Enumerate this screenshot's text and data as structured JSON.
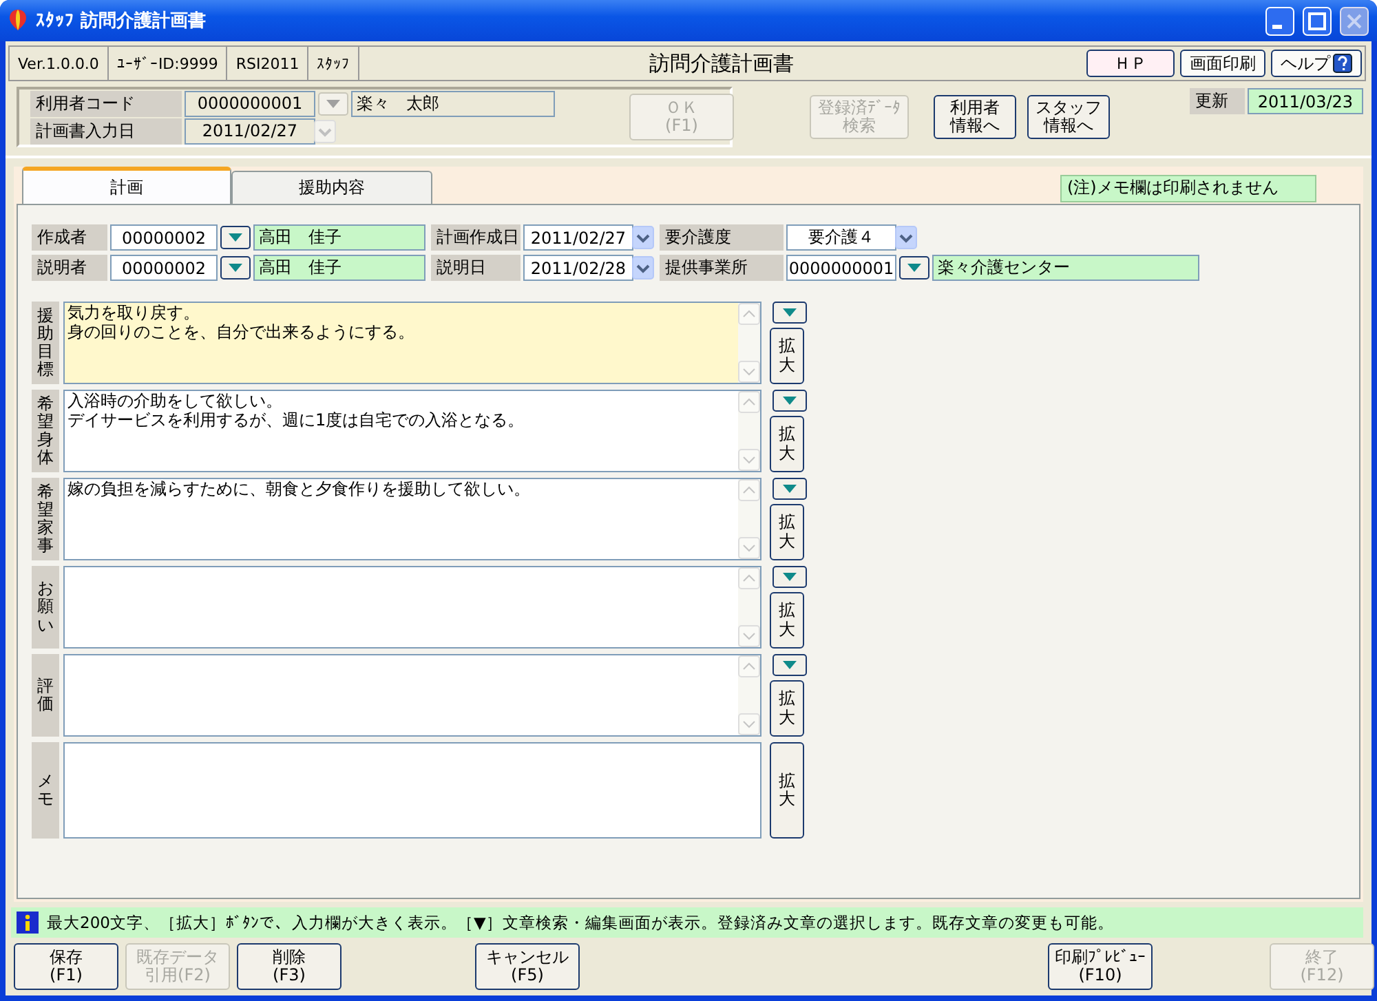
{
  "window": {
    "title": "ｽﾀｯﾌ 訪問介護計画書"
  },
  "info_bar": {
    "cells": [
      "Ver.1.0.0.0",
      "ﾕｰｻﾞｰID:9999",
      "RSI2011",
      "ｽﾀｯﾌ"
    ],
    "screen_title": "訪問介護計画書",
    "buttons": [
      {
        "label": "ＨＰ",
        "kind": "plain"
      },
      {
        "label": "画面印刷",
        "kind": "plain"
      },
      {
        "label": "ヘルプ",
        "kind": "help"
      }
    ]
  },
  "header": {
    "user_code": {
      "label": "利用者コード",
      "value": "0000000001",
      "name": "楽々　太郎",
      "disabled": true
    },
    "plan_date": {
      "label": "計画書入力日",
      "value": "2011/02/27",
      "disabled": true
    },
    "ok_button": {
      "lines": [
        "ＯＫ",
        "(F1)"
      ],
      "disabled": true
    },
    "buttons": [
      {
        "lines": [
          "登録済ﾃﾞｰﾀ",
          "検索"
        ],
        "disabled": true
      },
      {
        "lines": [
          "利用者",
          "情報へ"
        ],
        "disabled": false
      },
      {
        "lines": [
          "スタッフ",
          "情報へ"
        ],
        "disabled": false
      }
    ],
    "updated": {
      "label": "更新",
      "value": "2011/03/23"
    }
  },
  "tabs": [
    {
      "label": "計画",
      "selected": true
    },
    {
      "label": "援助内容",
      "selected": false
    }
  ],
  "note": "(注)メモ欄は印刷されません",
  "fields": [
    [
      {
        "kind": "lookup",
        "label": "作成者",
        "code": "00000002",
        "name": "高田　佳子"
      },
      {
        "kind": "date",
        "label": "計画作成日",
        "value": "2011/02/27"
      },
      {
        "kind": "select",
        "label": "要介護度",
        "value": "要介護４"
      }
    ],
    [
      {
        "kind": "lookup",
        "label": "説明者",
        "code": "00000002",
        "name": "高田　佳子"
      },
      {
        "kind": "date",
        "label": "説明日",
        "value": "2011/02/28"
      },
      {
        "kind": "lookup_wide",
        "label": "提供事業所",
        "code": "0000000001",
        "name": "楽々介護センター"
      }
    ]
  ],
  "sections": [
    {
      "label": "援助目標",
      "lines": [
        "気力を取り戻す。",
        "身の回りのことを、自分で出来るようにする。"
      ],
      "highlighted": true,
      "picker": true,
      "expand": "拡大"
    },
    {
      "label": "希望身体",
      "lines": [
        "入浴時の介助をして欲しい。",
        "デイサービスを利用するが、週に1度は自宅での入浴となる。"
      ],
      "highlighted": false,
      "picker": true,
      "expand": "拡大"
    },
    {
      "label": "希望家事",
      "lines": [
        "嫁の負担を減らすために、朝食と夕食作りを援助して欲しい。"
      ],
      "highlighted": false,
      "picker": true,
      "expand": "拡大"
    },
    {
      "label": "お願い",
      "highlighted": false,
      "picker": true,
      "expand": "拡大"
    },
    {
      "label": "評価",
      "highlighted": false,
      "picker": true,
      "expand": "拡大"
    },
    {
      "label": "メモ",
      "highlighted": false,
      "picker": false,
      "expand": "拡大"
    }
  ],
  "status": "最大200文字、［拡大］ﾎﾞﾀﾝで、入力欄が大きく表示。［▼］文章検索・編集画面が表示。登録済み文章の選択します。既存文章の変更も可能。",
  "footer": [
    {
      "lines": [
        "保存",
        "(F1)"
      ],
      "disabled": false
    },
    {
      "lines": [
        "既存データ",
        "引用(F2)"
      ],
      "disabled": true
    },
    {
      "lines": [
        "削除",
        "(F3)"
      ],
      "disabled": false
    },
    {
      "lines": [
        "キャンセル",
        "(F5)"
      ],
      "disabled": false
    },
    {
      "lines": [
        "印刷ﾌﾟﾚﾋﾞｭｰ",
        "(F10)"
      ],
      "disabled": false
    },
    {
      "lines": [
        "終了",
        "(F12)"
      ],
      "disabled": true
    }
  ]
}
